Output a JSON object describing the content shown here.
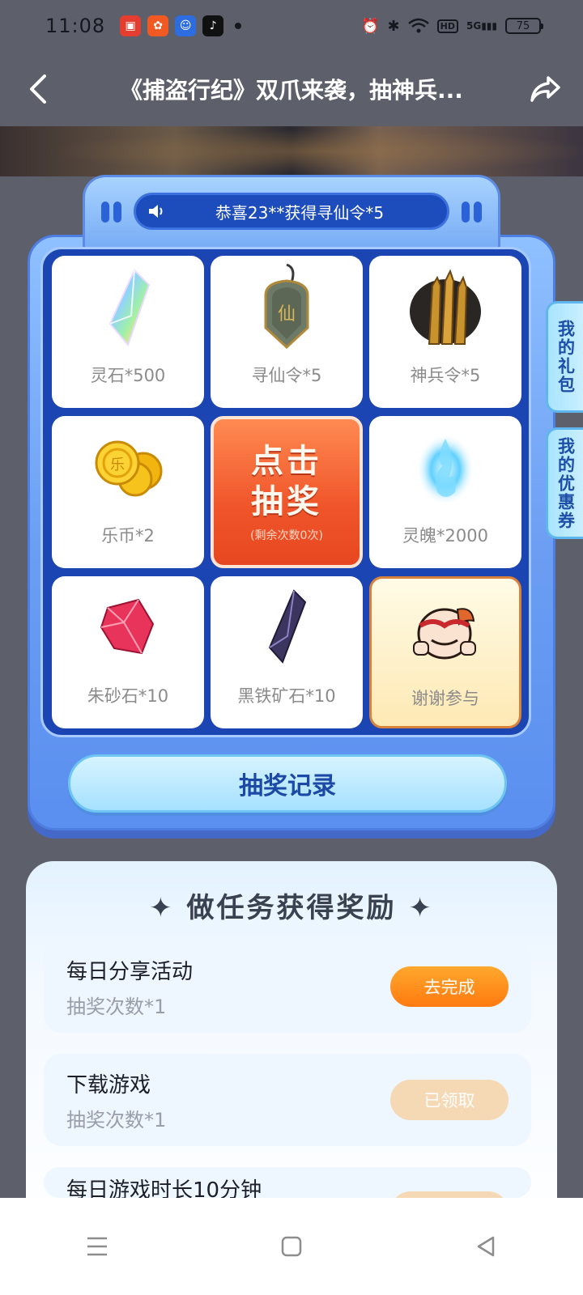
{
  "status_bar": {
    "time": "11:08",
    "battery": "75",
    "hd": "HD",
    "network": "5G"
  },
  "header": {
    "title": "《捕盗行纪》双爪来袭，抽神兵..."
  },
  "ticker": {
    "text": "恭喜23**获得寻仙令*5"
  },
  "prizes": [
    {
      "label": "灵石*500",
      "icon": "crystal-icon"
    },
    {
      "label": "寻仙令*5",
      "icon": "jade-token-icon"
    },
    {
      "label": "神兵令*5",
      "icon": "weapon-token-icon"
    },
    {
      "label": "乐币*2",
      "icon": "coin-icon"
    },
    {
      "label": "灵魄*2000",
      "icon": "soul-flame-icon"
    },
    {
      "label": "朱砂石*10",
      "icon": "red-gem-icon"
    },
    {
      "label": "黑铁矿石*10",
      "icon": "black-ore-icon"
    },
    {
      "label": "谢谢参与",
      "icon": "mascot-icon"
    }
  ],
  "draw_button": {
    "line1": "点击",
    "line2": "抽奖",
    "remaining": "(剩余次数0次)"
  },
  "record_button": "抽奖记录",
  "side_tabs": {
    "gifts": "我的礼包",
    "coupons": "我的优惠券"
  },
  "tasks": {
    "title": "做任务获得奖励",
    "items": [
      {
        "name": "每日分享活动",
        "reward": "抽奖次数*1",
        "button": "去完成",
        "state": "active"
      },
      {
        "name": "下载游戏",
        "reward": "抽奖次数*1",
        "button": "已领取",
        "state": "done"
      },
      {
        "name": "每日游戏时长10分钟",
        "reward": "",
        "button": "",
        "state": "done"
      }
    ]
  },
  "colors": {
    "accent_blue": "#1d4cbd",
    "draw_orange": "#f0552a",
    "task_orange": "#ff7a10"
  }
}
